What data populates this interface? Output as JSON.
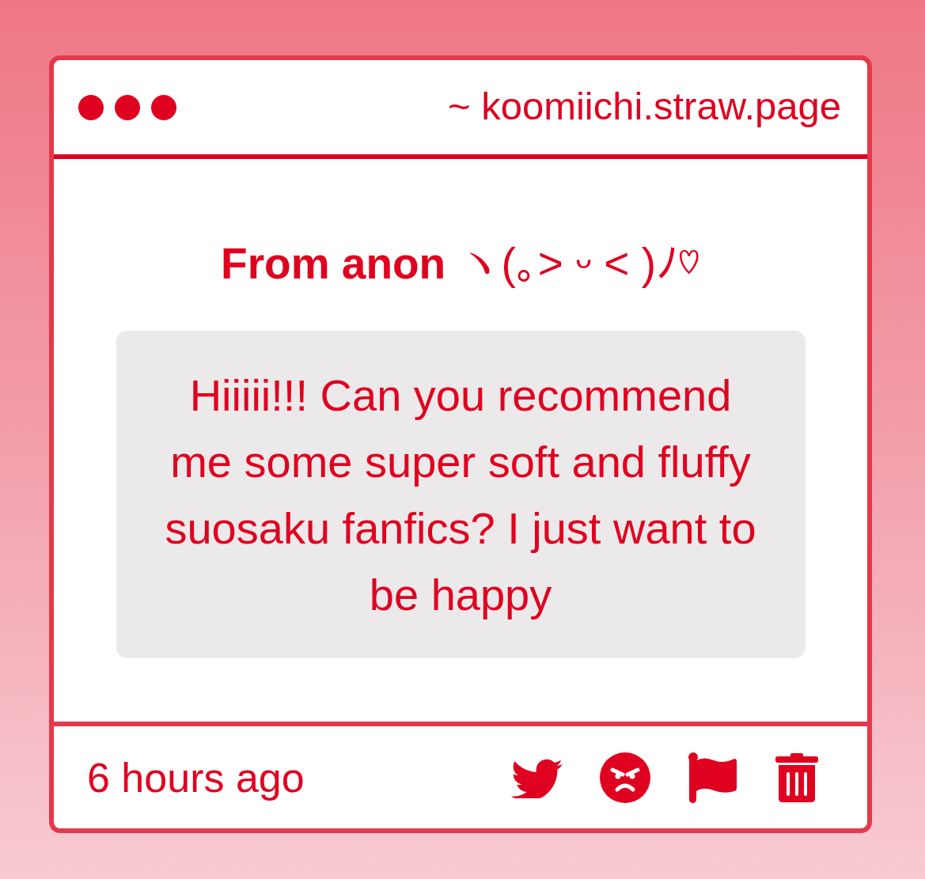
{
  "window": {
    "url": "~ koomiichi.straw.page"
  },
  "question": {
    "title": "**From anon** ヽ(｡˃ ᵕ ˂ )ﾉ♡",
    "message": "Hiiiii!!! Can you recommend me some super soft and fluffy suosaku fanfics? I just want to be happy"
  },
  "footer": {
    "time": "6 hours ago"
  }
}
